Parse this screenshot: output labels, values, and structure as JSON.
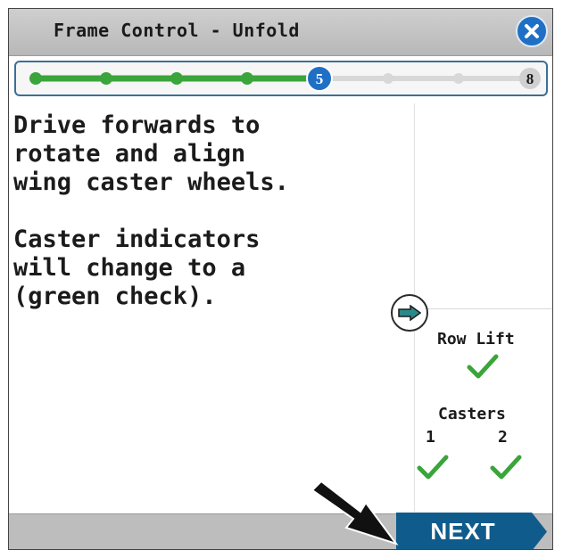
{
  "header": {
    "title": "Frame Control - Unfold",
    "close_icon": "close-icon"
  },
  "progress": {
    "current_step": 5,
    "total_steps": 8,
    "current_label": "5",
    "total_label": "8",
    "completed_color": "#3aa53a",
    "current_color": "#1f6fc5",
    "pending_color": "#d8d8d8"
  },
  "instructions": {
    "paragraph1": "Drive forwards to\nrotate and align\nwing caster wheels.",
    "paragraph2": "Caster indicators\nwill change to a\n(green check)."
  },
  "status": {
    "row_lift_label": "Row Lift",
    "casters_label": "Casters",
    "caster1_label": "1",
    "caster2_label": "2",
    "check_color": "#3aa53a"
  },
  "navigation": {
    "next_label": "NEXT",
    "next_color": "#0f5c8c",
    "arrow_icon": "arrow-right-icon"
  }
}
